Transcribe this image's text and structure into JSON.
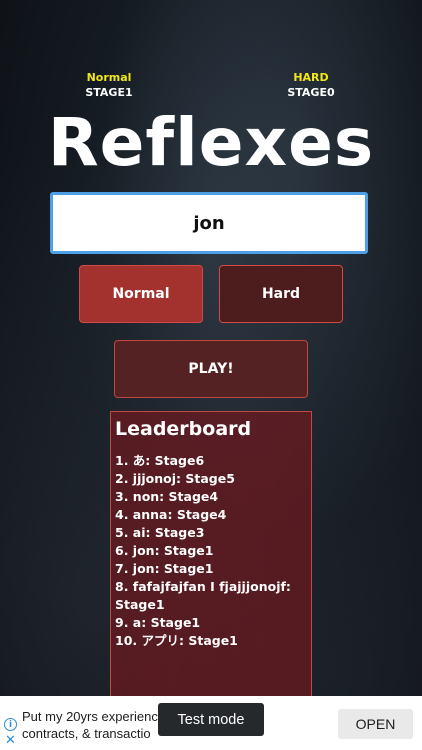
{
  "header": {
    "normal": {
      "mode": "Normal",
      "stage": "STAGE1"
    },
    "hard": {
      "mode": "HARD",
      "stage": "STAGE0"
    }
  },
  "title": "Reflexes",
  "name_input": {
    "value": "jon",
    "placeholder": ""
  },
  "modes": {
    "normal_label": "Normal",
    "hard_label": "Hard",
    "selected": "Normal"
  },
  "play_label": "PLAY!",
  "leaderboard": {
    "title": "Leaderboard",
    "entries": [
      "1. あ: Stage6",
      "2. jjjonoj: Stage5",
      "3. non: Stage4",
      "4. anna: Stage4",
      "5. ai: Stage3",
      "6. jon: Stage1",
      "7. jon: Stage1",
      "8. fafajfajfan I fjajjjonojf: Stage1",
      "9. a: Stage1",
      "10. アプリ: Stage1"
    ]
  },
  "ad": {
    "text": "Put my 20yrs experience\ncontracts, & transactio",
    "open_label": "OPEN",
    "test_mode_label": "Test mode"
  }
}
